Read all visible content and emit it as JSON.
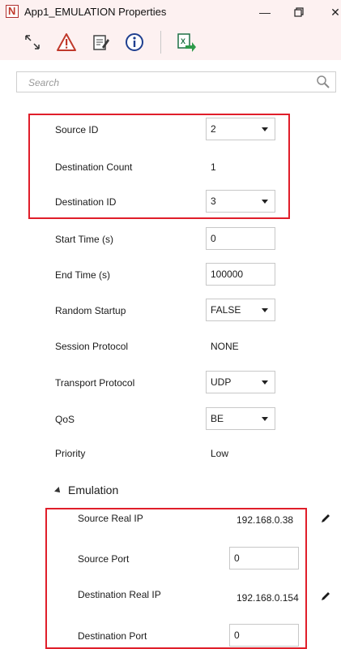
{
  "window": {
    "title": "App1_EMULATION Properties"
  },
  "search": {
    "placeholder": "Search"
  },
  "properties": {
    "source_id": {
      "label": "Source ID",
      "value": "2"
    },
    "destination_count": {
      "label": "Destination Count",
      "value": "1"
    },
    "destination_id": {
      "label": "Destination ID",
      "value": "3"
    },
    "start_time": {
      "label": "Start Time (s)",
      "value": "0"
    },
    "end_time": {
      "label": "End Time (s)",
      "value": "100000"
    },
    "random_startup": {
      "label": "Random Startup",
      "value": "FALSE"
    },
    "session_protocol": {
      "label": "Session Protocol",
      "value": "NONE"
    },
    "transport_protocol": {
      "label": "Transport Protocol",
      "value": "UDP"
    },
    "qos": {
      "label": "QoS",
      "value": "BE"
    },
    "priority": {
      "label": "Priority",
      "value": "Low"
    }
  },
  "emulation": {
    "section_label": "Emulation",
    "source_real_ip": {
      "label": "Source Real IP",
      "value": "192.168.0.38"
    },
    "source_port": {
      "label": "Source Port",
      "value": "0"
    },
    "destination_real_ip": {
      "label": "Destination Real IP",
      "value": "192.168.0.154"
    },
    "destination_port": {
      "label": "Destination Port",
      "value": "0"
    }
  },
  "colors": {
    "highlight_border": "#e01e2a",
    "title_bg": "#fdf1f1"
  }
}
